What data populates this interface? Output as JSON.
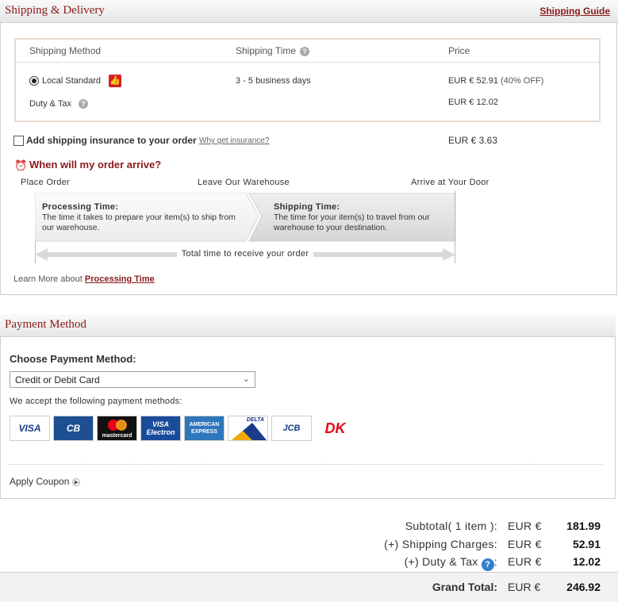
{
  "shipping": {
    "title": "Shipping & Delivery",
    "guide_link": "Shipping Guide",
    "table": {
      "headers": {
        "method": "Shipping Method",
        "time": "Shipping Time",
        "price": "Price"
      },
      "method": {
        "name": "Local Standard",
        "time": "3 - 5 business days",
        "price": "EUR € 52.91",
        "discount": "(40% OFF)"
      },
      "duty": {
        "label": "Duty & Tax",
        "price": "EUR € 12.02"
      }
    },
    "insurance": {
      "label": "Add shipping insurance to your order",
      "link": "Why get insurance?",
      "price": "EUR € 3.63"
    },
    "arrival": {
      "title": "When will my order arrive?",
      "steps": [
        "Place Order",
        "Leave Our Warehouse",
        "Arrive at Your Door"
      ],
      "processing": {
        "title": "Processing Time:",
        "text": "The time it takes to prepare your item(s) to ship from our warehouse."
      },
      "shipping_time": {
        "title": "Shipping Time:",
        "text": "The time  for your item(s) to travel from our warehouse to your destination."
      },
      "total": "Total time to receive your order"
    },
    "learn_more": {
      "prefix": "Learn More about",
      "link": "Processing Time"
    }
  },
  "payment": {
    "title": "Payment Method",
    "choose_label": "Choose Payment Method:",
    "selected": "Credit or Debit Card",
    "accept_text": "We accept the following payment methods:",
    "cards": [
      {
        "label": "VISA",
        "color": "#1a3a8c",
        "bg": "#ffffff"
      },
      {
        "label": "CB",
        "color": "#ffffff",
        "bg": "#1d4f91"
      },
      {
        "label": "mastercard",
        "color": "#ffffff",
        "bg": "#111111"
      },
      {
        "label": "VISA Electron",
        "color": "#ffffff",
        "bg": "#1a4c9c"
      },
      {
        "label": "AMERICAN EXPRESS",
        "color": "#ffffff",
        "bg": "#2e77bb"
      },
      {
        "label": "DELTA",
        "color": "#1a3a8c",
        "bg": "#ffffff"
      },
      {
        "label": "JCB",
        "color": "#1a3a8c",
        "bg": "#ffffff"
      },
      {
        "label": "DK",
        "color": "#e10b17",
        "bg": "#ffffff"
      }
    ],
    "coupon": "Apply Coupon"
  },
  "totals": {
    "subtotal": {
      "label": "Subtotal( 1 item ):",
      "currency": "EUR €",
      "value": "181.99"
    },
    "shipping": {
      "label": "(+) Shipping Charges:",
      "currency": "EUR €",
      "value": "52.91"
    },
    "duty": {
      "label": "(+) Duty & Tax",
      "currency": "EUR €",
      "value": "12.02"
    },
    "grand": {
      "label": "Grand Total:",
      "currency": "EUR €",
      "value": "246.92"
    }
  },
  "colors": {
    "brand": "#8b1a1a",
    "accent_blue": "#2f7fd1"
  }
}
